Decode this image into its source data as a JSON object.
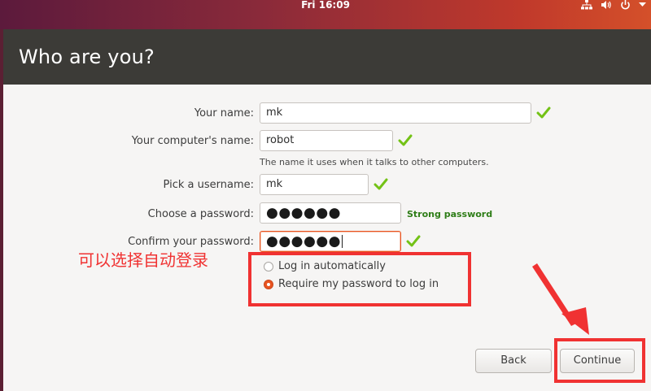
{
  "topbar": {
    "clock": "Fri 16:09",
    "icons": [
      "network-icon",
      "volume-icon",
      "power-icon",
      "chevron-down-icon"
    ]
  },
  "window": {
    "title": "Who are you?"
  },
  "form": {
    "name_label": "Your name:",
    "name_value": "mk",
    "computer_label": "Your computer's name:",
    "computer_value": "robot",
    "computer_hint": "The name it uses when it talks to other computers.",
    "username_label": "Pick a username:",
    "username_value": "mk",
    "password_label": "Choose a password:",
    "password_value": "●●●●●●",
    "password_strength": "Strong password",
    "confirm_label": "Confirm your password:",
    "confirm_value": "●●●●●●"
  },
  "login": {
    "auto_label": "Log in automatically",
    "auto_selected": false,
    "require_label": "Require my password to log in",
    "require_selected": true
  },
  "annotation": {
    "text": "可以选择自动登录",
    "color": "#f03232"
  },
  "buttons": {
    "back": "Back",
    "continue": "Continue"
  },
  "colors": {
    "accent": "#e95420",
    "header": "#3c3b37",
    "valid_check": "#73c216",
    "strength": "#2e7d17"
  }
}
